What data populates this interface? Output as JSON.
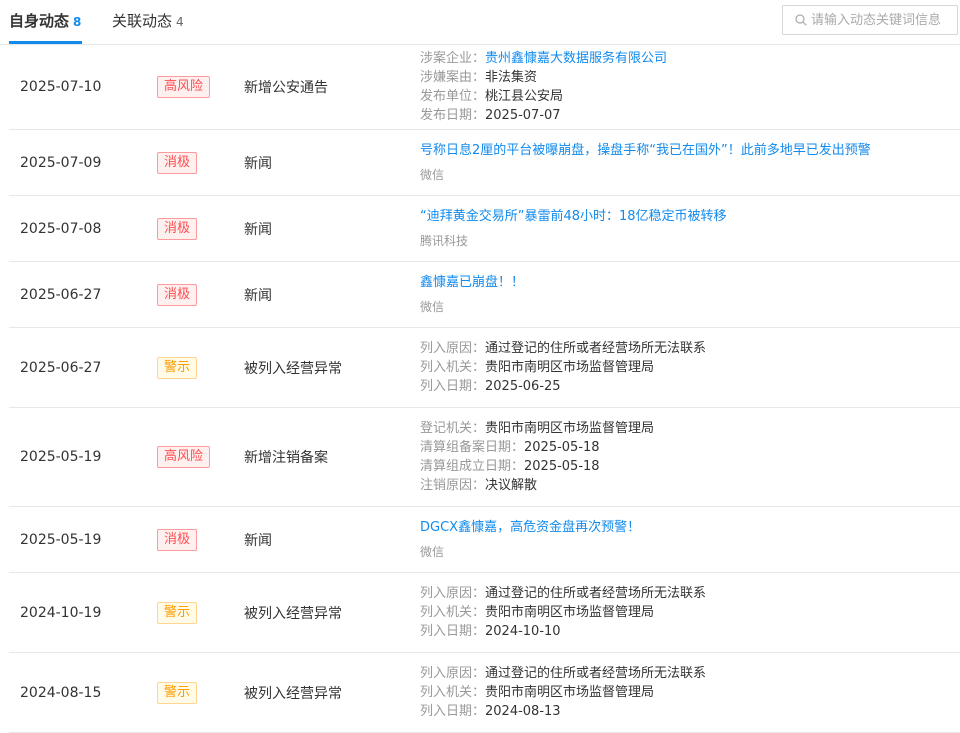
{
  "tabs": [
    {
      "label": "自身动态",
      "count": "8"
    },
    {
      "label": "关联动态",
      "count": "4"
    }
  ],
  "search": {
    "placeholder": "请输入动态关键词信息",
    "value": ""
  },
  "colors": {
    "accent": "#128bed",
    "risk_red": "#ff4d4f",
    "warn_orange": "#ff9b00"
  },
  "rows": [
    {
      "date": "2025-07-10",
      "level": "高风险",
      "level_kind": "high",
      "type": "新增公安通告",
      "details": [
        {
          "k": "涉案企业：",
          "v": "贵州鑫慷嘉大数据服务有限公司"
        },
        {
          "k": "涉嫌案由：",
          "v": "非法集资"
        },
        {
          "k": "发布单位：",
          "v": "桃江县公安局"
        },
        {
          "k": "发布日期：",
          "v": "2025-07-07"
        }
      ]
    },
    {
      "date": "2025-07-09",
      "level": "消极",
      "level_kind": "neg",
      "type": "新闻",
      "news": {
        "title": "号称日息2厘的平台被曝崩盘，操盘手称“我已在国外”！此前多地早已发出预警",
        "source": "微信"
      }
    },
    {
      "date": "2025-07-08",
      "level": "消极",
      "level_kind": "neg",
      "type": "新闻",
      "news": {
        "title": "“迪拜黄金交易所”暴雷前48小时：18亿稳定币被转移",
        "source": "腾讯科技"
      }
    },
    {
      "date": "2025-06-27",
      "level": "消极",
      "level_kind": "neg",
      "type": "新闻",
      "news": {
        "title": "鑫慷嘉已崩盘！！",
        "source": "微信"
      }
    },
    {
      "date": "2025-06-27",
      "level": "警示",
      "level_kind": "warn",
      "type": "被列入经营异常",
      "details": [
        {
          "k": "列入原因：",
          "v": "通过登记的住所或者经营场所无法联系"
        },
        {
          "k": "列入机关：",
          "v": "贵阳市南明区市场监督管理局"
        },
        {
          "k": "列入日期：",
          "v": "2025-06-25"
        }
      ]
    },
    {
      "date": "2025-05-19",
      "level": "高风险",
      "level_kind": "high",
      "type": "新增注销备案",
      "details": [
        {
          "k": "登记机关：",
          "v": "贵阳市南明区市场监督管理局"
        },
        {
          "k": "清算组备案日期：",
          "v": "2025-05-18"
        },
        {
          "k": "清算组成立日期：",
          "v": "2025-05-18"
        },
        {
          "k": "注销原因：",
          "v": "决议解散"
        }
      ]
    },
    {
      "date": "2025-05-19",
      "level": "消极",
      "level_kind": "neg",
      "type": "新闻",
      "news": {
        "title": "DGCX鑫慷嘉，高危资金盘再次预警！",
        "source": "微信"
      }
    },
    {
      "date": "2024-10-19",
      "level": "警示",
      "level_kind": "warn",
      "type": "被列入经营异常",
      "details": [
        {
          "k": "列入原因：",
          "v": "通过登记的住所或者经营场所无法联系"
        },
        {
          "k": "列入机关：",
          "v": "贵阳市南明区市场监督管理局"
        },
        {
          "k": "列入日期：",
          "v": "2024-10-10"
        }
      ]
    },
    {
      "date": "2024-08-15",
      "level": "警示",
      "level_kind": "warn",
      "type": "被列入经营异常",
      "details": [
        {
          "k": "列入原因：",
          "v": "通过登记的住所或者经营场所无法联系"
        },
        {
          "k": "列入机关：",
          "v": "贵阳市南明区市场监督管理局"
        },
        {
          "k": "列入日期：",
          "v": "2024-08-13"
        }
      ]
    }
  ]
}
